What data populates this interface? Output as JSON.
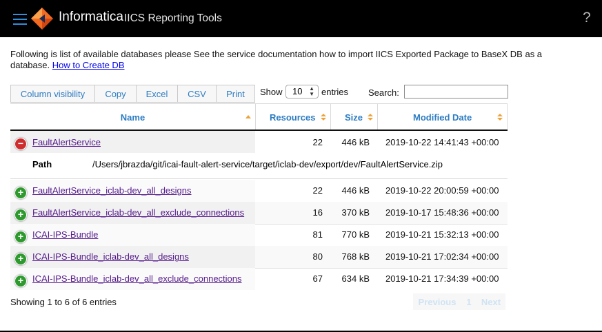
{
  "header": {
    "brand": "Informatica",
    "app_title": "IICS Reporting Tools",
    "help": "?"
  },
  "intro": {
    "text": "Following is list of available databases please See the service documentation how to import IICS Exported Package to BaseX DB as a database.",
    "link": "How to Create DB"
  },
  "toolbar": {
    "buttons": [
      "Column visibility",
      "Copy",
      "Excel",
      "CSV",
      "Print"
    ],
    "show_label": "Show",
    "page_length": "10",
    "entries_label": "entries",
    "search_label": "Search:",
    "search_value": ""
  },
  "table": {
    "columns": [
      "Name",
      "Resources",
      "Size",
      "Modified Date"
    ],
    "rows": [
      {
        "name": "FaultAlertService",
        "resources": "22",
        "size": "446 kB",
        "modified": "2019-10-22 14:41:43 +00:00",
        "expanded": true
      },
      {
        "name": "FaultAlertService_iclab-dev_all_designs",
        "resources": "22",
        "size": "446 kB",
        "modified": "2019-10-22 20:00:59 +00:00",
        "expanded": false
      },
      {
        "name": "FaultAlertService_iclab-dev_all_exclude_connections",
        "resources": "16",
        "size": "370 kB",
        "modified": "2019-10-17 15:48:36 +00:00",
        "expanded": false
      },
      {
        "name": "ICAI-IPS-Bundle",
        "resources": "81",
        "size": "770 kB",
        "modified": "2019-10-21 15:32:13 +00:00",
        "expanded": false
      },
      {
        "name": "ICAI-IPS-Bundle_iclab-dev_all_designs",
        "resources": "80",
        "size": "768 kB",
        "modified": "2019-10-21 17:02:34 +00:00",
        "expanded": false
      },
      {
        "name": "ICAI-IPS-Bundle_iclab-dev_all_exclude_connections",
        "resources": "67",
        "size": "634 kB",
        "modified": "2019-10-21 17:34:39 +00:00",
        "expanded": false
      }
    ],
    "detail": {
      "label": "Path",
      "value": "/Users/jbrazda/git/icai-fault-alert-service/target/iclab-dev/export/dev/FaultAlertService.zip"
    }
  },
  "footer": {
    "info": "Showing 1 to 6 of 6 entries",
    "previous": "Previous",
    "page": "1",
    "next": "Next"
  },
  "colors": {
    "accent": "#2d7cc2",
    "minus": "#cf2d2d",
    "plus": "#2e9a2e",
    "link_visited": "#551a8b"
  }
}
